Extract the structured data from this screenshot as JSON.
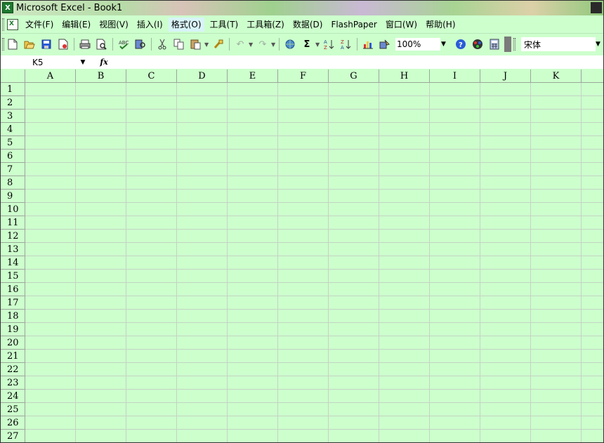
{
  "window": {
    "title": "Microsoft Excel - Book1"
  },
  "menubar": {
    "items": [
      "文件(F)",
      "编辑(E)",
      "视图(V)",
      "插入(I)",
      "格式(O)",
      "工具(T)",
      "工具箱(Z)",
      "数据(D)",
      "FlashPaper",
      "窗口(W)",
      "帮助(H)"
    ]
  },
  "toolbar": {
    "zoom": "100%",
    "font": "宋体",
    "icons": [
      "new-icon",
      "open-icon",
      "save-icon",
      "permission-icon",
      "print-icon",
      "print-preview-icon",
      "spelling-icon",
      "research-icon",
      "cut-icon",
      "copy-icon",
      "paste-icon",
      "format-painter-icon",
      "undo-icon",
      "redo-icon",
      "hyperlink-icon",
      "autosum-icon",
      "sort-ascending-icon",
      "sort-descending-icon",
      "chart-wizard-icon",
      "drawing-icon",
      "help-icon",
      "color-icon",
      "calculator-icon"
    ]
  },
  "formula_bar": {
    "name_box": "K5",
    "fx": "fx",
    "formula": ""
  },
  "sheet": {
    "columns": [
      "A",
      "B",
      "C",
      "D",
      "E",
      "F",
      "G",
      "H",
      "I",
      "J",
      "K"
    ],
    "rows": [
      "1",
      "2",
      "3",
      "4",
      "5",
      "6",
      "7",
      "8",
      "9",
      "10",
      "11",
      "12",
      "13",
      "14",
      "15",
      "16",
      "17",
      "18",
      "19",
      "20",
      "21",
      "22",
      "23",
      "24",
      "25",
      "26",
      "27"
    ]
  }
}
